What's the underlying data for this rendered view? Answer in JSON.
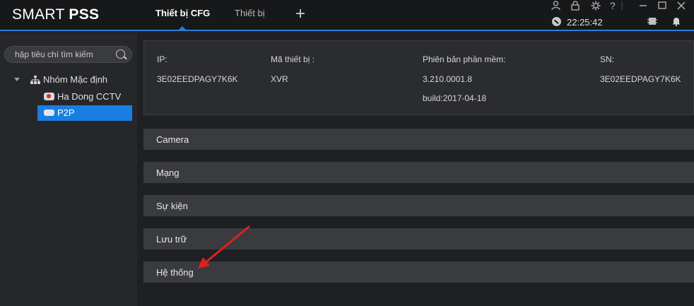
{
  "app": {
    "name_light": "SMART ",
    "name_bold": "PSS"
  },
  "tabs": [
    {
      "label": "Thiết bị CFG",
      "active": true
    },
    {
      "label": "Thiết bị",
      "active": false
    }
  ],
  "add_tab_glyph": "+",
  "window_icons": [
    "user-icon",
    "lock-icon",
    "gear-icon",
    "help-icon",
    "minimize-icon",
    "maximize-icon",
    "close-icon"
  ],
  "status": {
    "time": "22:25:42"
  },
  "sidebar": {
    "search_placeholder": "hập tiêu chí tìm kiếm",
    "group_label": "Nhóm Mặc định",
    "devices": [
      {
        "label": "Ha Dong CCTV",
        "selected": false
      },
      {
        "label": "P2P",
        "selected": true
      }
    ]
  },
  "device_info": {
    "ip_label": "IP:",
    "ip_value": "3E02EEDPAGY7K6K",
    "device_code_label": "Mã thiết bị :",
    "device_code_value": "XVR",
    "software_label": "Phiên bản phần mềm:",
    "software_version": "3.210.0001.8",
    "software_build": "build:2017-04-18",
    "sn_label": "SN:",
    "sn_value": "3E02EEDPAGY7K6K"
  },
  "sections": [
    {
      "label": "Camera"
    },
    {
      "label": "Mạng"
    },
    {
      "label": "Sự kiện"
    },
    {
      "label": "Lưu trữ"
    },
    {
      "label": "Hệ thống"
    }
  ],
  "colors": {
    "accent": "#1a7de0",
    "annotation_arrow": "#e02020"
  }
}
